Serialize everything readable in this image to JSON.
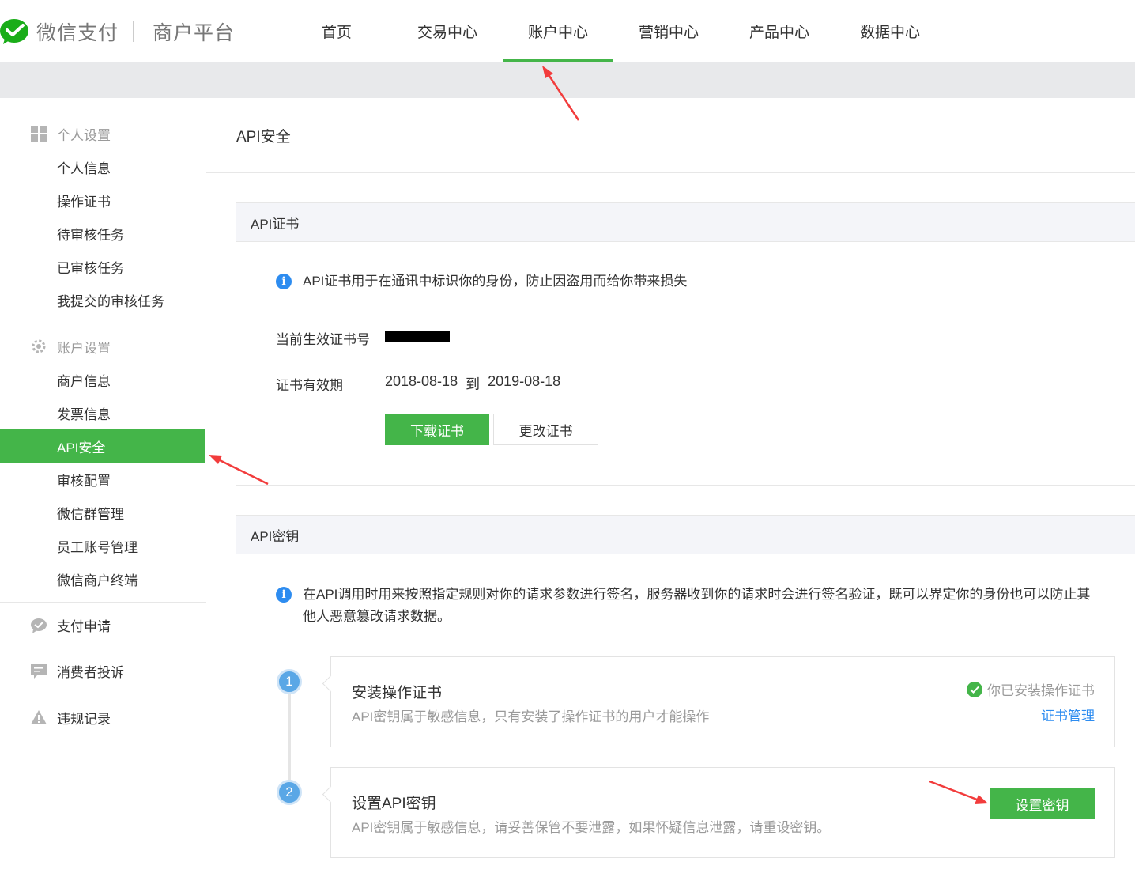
{
  "header": {
    "brand": "微信支付",
    "platform": "商户平台",
    "nav": [
      {
        "label": "首页",
        "active": false
      },
      {
        "label": "交易中心",
        "active": false
      },
      {
        "label": "账户中心",
        "active": true
      },
      {
        "label": "营销中心",
        "active": false
      },
      {
        "label": "产品中心",
        "active": false
      },
      {
        "label": "数据中心",
        "active": false
      }
    ]
  },
  "sidebar": {
    "personal": {
      "title": "个人设置",
      "items": [
        "个人信息",
        "操作证书",
        "待审核任务",
        "已审核任务",
        "我提交的审核任务"
      ]
    },
    "account": {
      "title": "账户设置",
      "items": [
        "商户信息",
        "发票信息",
        "API安全",
        "审核配置",
        "微信群管理",
        "员工账号管理",
        "微信商户终端"
      ],
      "active_index": 2
    },
    "pay_apply": "支付申请",
    "complaints": "消费者投诉",
    "violations": "违规记录"
  },
  "main": {
    "title": "API安全",
    "cert": {
      "heading": "API证书",
      "info": "API证书用于在通讯中标识你的身份，防止因盗用而给你带来损失",
      "current_label": "当前生效证书号",
      "validity_label": "证书有效期",
      "validity_from": "2018-08-18",
      "validity_to_word": "到",
      "validity_to": "2019-08-18",
      "download_btn": "下载证书",
      "change_btn": "更改证书"
    },
    "key": {
      "heading": "API密钥",
      "info_line1": "在API调用时用来按照指定规则对你的请求参数进行签名，服务器收到你的请求时会进行签名验证，既可以界定你的身份也可以防止其",
      "info_line2": "他人恶意篡改请求数据。",
      "step1": {
        "number": "1",
        "title": "安装操作证书",
        "desc": "API密钥属于敏感信息，只有安装了操作证书的用户才能操作",
        "status": "你已安装操作证书",
        "link": "证书管理"
      },
      "step2": {
        "number": "2",
        "title": "设置API密钥",
        "desc": "API密钥属于敏感信息，请妥善保管不要泄露，如果怀疑信息泄露，请重设密钥。",
        "button": "设置密钥"
      }
    }
  },
  "colors": {
    "accent": "#44b549",
    "info": "#2d8cf0",
    "annotation": "#f23c3c"
  }
}
